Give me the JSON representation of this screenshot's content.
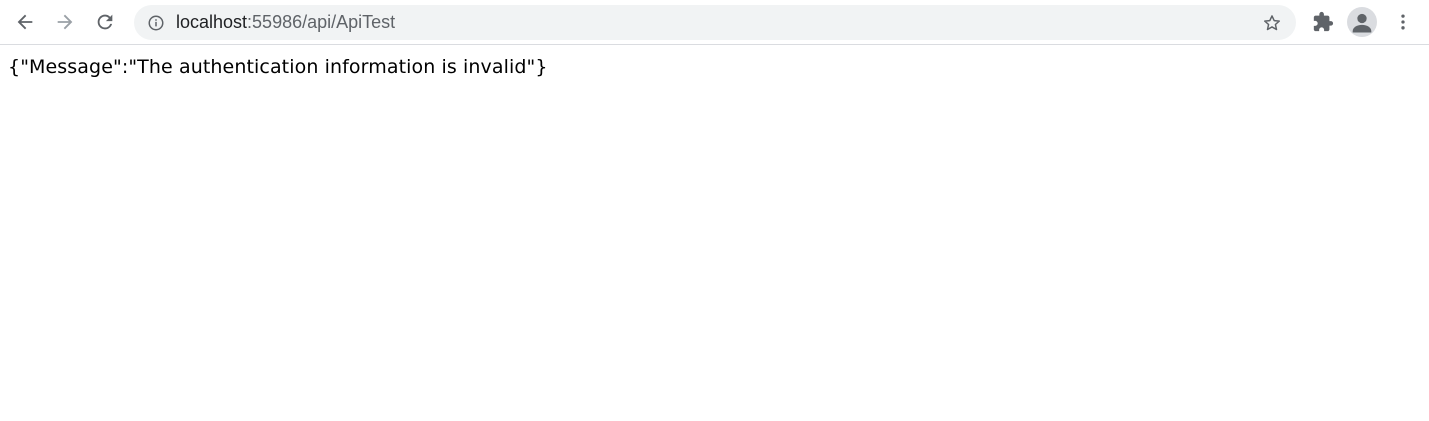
{
  "browser": {
    "address_bar": {
      "host": "localhost",
      "path": ":55986/api/ApiTest"
    },
    "icons": {
      "back": "back-arrow-icon",
      "forward": "forward-arrow-icon",
      "reload": "reload-icon",
      "site_info": "info-icon",
      "bookmark": "star-icon",
      "extensions": "puzzle-icon",
      "profile": "person-icon",
      "menu": "kebab-menu-icon"
    },
    "colors": {
      "toolbar_bg": "#ffffff",
      "omnibox_bg": "#f1f3f4",
      "icon_color": "#5f6368",
      "icon_disabled": "#9aa0a6"
    }
  },
  "page": {
    "body_text": "{\"Message\":\"The authentication information is invalid\"}"
  }
}
